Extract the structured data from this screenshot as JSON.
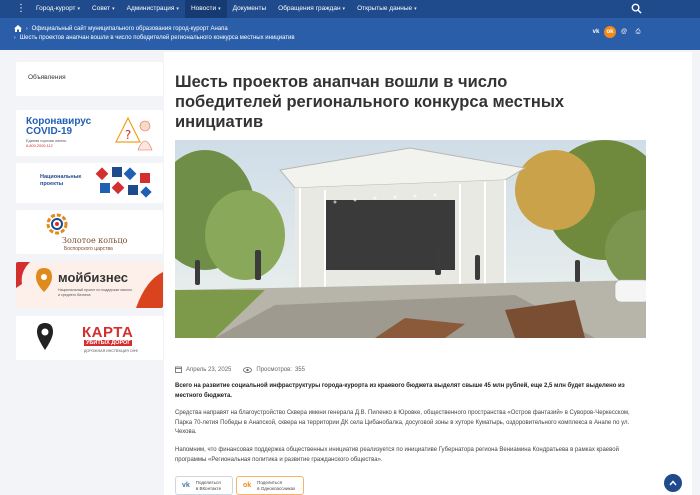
{
  "topnav": {
    "items": [
      {
        "label": "Город-курорт",
        "caret": true
      },
      {
        "label": "Совет",
        "caret": true
      },
      {
        "label": "Администрация",
        "caret": true
      },
      {
        "label": "Новости",
        "caret": true
      },
      {
        "label": "Документы",
        "caret": false
      },
      {
        "label": "Обращения граждан",
        "caret": true
      },
      {
        "label": "Открытые данные",
        "caret": true
      }
    ],
    "active_index": 3
  },
  "breadcrumb": {
    "level1": "Официальный сайт муниципального образования город-курорт Анапа",
    "level2": "Шесть проектов анапчан вошли в число победителей регионального конкурса местных инициатив"
  },
  "social_header": [
    "vk",
    "ok",
    "mail",
    "print"
  ],
  "social_header_labels": {
    "vk": "vk",
    "ok": "ok",
    "mail": "@",
    "print": "⎙"
  },
  "sidebar": {
    "announcements_label": "Объявления",
    "covid": {
      "title_line1": "Коронавирус",
      "title_line2": "COVID-19",
      "hotline_label": "Единая горячая линия:",
      "hotline_number": "8-800-2000-112"
    },
    "nat_projects": {
      "line1": "Национальные",
      "line2": "проекты"
    },
    "golden_ring": {
      "line1": "Золотое кольцо",
      "line2": "Боспорского царства"
    },
    "mybiz": {
      "name": "мойбизнес",
      "sub1": "Национальный проект по поддержке малого",
      "sub2": "и среднего бизнеса"
    },
    "roads": {
      "word1": "КАРТА",
      "word2": "УБИТЫХ ДОРОГ",
      "sub": "ДОРОЖНАЯ ИНСПЕКЦИЯ ОНФ"
    }
  },
  "article": {
    "title": "Шесть проектов анапчан вошли в число победителей регионального конкурса местных инициатив",
    "date": "Апрель 23, 2025",
    "views_label": "Просмотров:",
    "views": "355",
    "p1": "Всего на развитие социальной инфраструктуры города-курорта из краевого бюджета выделят свыше 45 млн рублей, еще 2,5 млн будет выделено из местного бюджета.",
    "p2": "Средства направят на благоустройство Сквера имени генерала Д.В. Пиленко в Юровке, общественного пространства «Остров фантазий» в Суворов-Черкесском, Парка 70-летия Победы в Анапской, сквера на территории ДК села Цибанобалка, досуговой зоны в хуторе Куматырь, оздоровительного комплекса в Анапе по ул. Чехова.",
    "p3": "Напомним, что финансовая поддержка общественных инициатив реализуется по инициативе Губернатора региона Вениамина Кондратьева в рамках краевой программы «Региональная политика и развитие гражданского общества»."
  },
  "share": {
    "vk": {
      "line1": "Поделиться",
      "line2": "в ВКонтакте"
    },
    "ok": {
      "line1": "Поделиться",
      "line2": "в Одноклассниках"
    }
  },
  "colors": {
    "nav": "#1f4a8c",
    "band": "#2b5ea8",
    "accent_red": "#d32f2f",
    "covid_blue": "#1f5fb4"
  }
}
